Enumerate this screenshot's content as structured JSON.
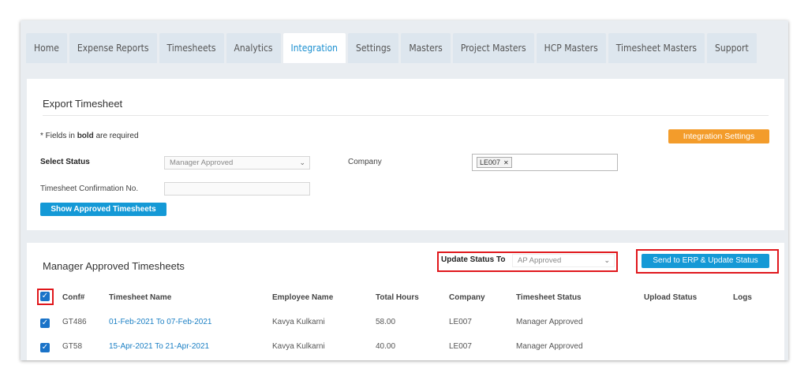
{
  "tabs": [
    {
      "label": "Home",
      "active": false
    },
    {
      "label": "Expense Reports",
      "active": false
    },
    {
      "label": "Timesheets",
      "active": false
    },
    {
      "label": "Analytics",
      "active": false
    },
    {
      "label": "Integration",
      "active": true
    },
    {
      "label": "Settings",
      "active": false
    },
    {
      "label": "Masters",
      "active": false
    },
    {
      "label": "Project Masters",
      "active": false
    },
    {
      "label": "HCP Masters",
      "active": false
    },
    {
      "label": "Timesheet Masters",
      "active": false
    },
    {
      "label": "Support",
      "active": false
    }
  ],
  "export": {
    "title": "Export Timesheet",
    "note_prefix": "* Fields in",
    "note_bold": "bold",
    "note_suffix": "are required",
    "integration_settings_label": "Integration Settings",
    "select_status_label": "Select Status",
    "select_status_value": "Manager Approved",
    "company_label": "Company",
    "company_chip": "LE007",
    "confirmation_label": "Timesheet Confirmation No.",
    "confirmation_value": "",
    "show_button_label": "Show Approved Timesheets"
  },
  "approved": {
    "title": "Manager Approved Timesheets",
    "update_status_label": "Update Status To",
    "update_status_value": "AP Approved",
    "send_button_label": "Send to ERP & Update Status",
    "columns": {
      "conf": "Conf#",
      "name": "Timesheet Name",
      "employee": "Employee Name",
      "hours": "Total Hours",
      "company": "Company",
      "status": "Timesheet Status",
      "upload": "Upload Status",
      "logs": "Logs"
    },
    "rows": [
      {
        "conf": "GT486",
        "name": "01-Feb-2021 To 07-Feb-2021",
        "employee": "Kavya Kulkarni",
        "hours": "58.00",
        "company": "LE007",
        "status": "Manager Approved"
      },
      {
        "conf": "GT58",
        "name": "15-Apr-2021 To 21-Apr-2021",
        "employee": "Kavya Kulkarni",
        "hours": "40.00",
        "company": "LE007",
        "status": "Manager Approved"
      }
    ]
  },
  "colors": {
    "accent": "#1499d6",
    "orange": "#f39c2b",
    "highlight": "#e0171c"
  }
}
